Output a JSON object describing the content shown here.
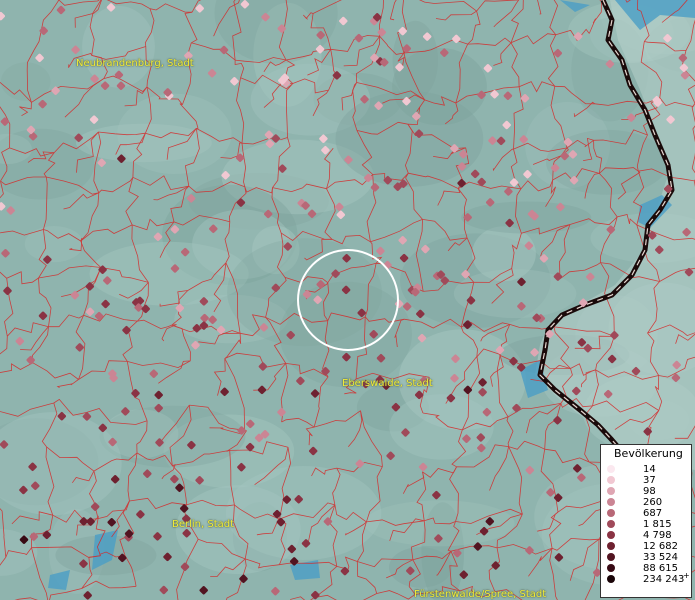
{
  "map": {
    "cities": [
      {
        "name": "Neubrandenburg, Stadt"
      },
      {
        "name": "Eberswalde, Stadt"
      },
      {
        "name": "Berlin, Stadt"
      },
      {
        "name": "Fürstenwalde/Spree, Stadt"
      }
    ],
    "legend": {
      "title": "Bevölkerung",
      "items": [
        {
          "label": "14",
          "color": "#fbe8ef"
        },
        {
          "label": "37",
          "color": "#f1c8d2"
        },
        {
          "label": "98",
          "color": "#dfa6b3"
        },
        {
          "label": "260",
          "color": "#cb8594"
        },
        {
          "label": "687",
          "color": "#b86877"
        },
        {
          "label": "1 815",
          "color": "#a04a5a"
        },
        {
          "label": "4 798",
          "color": "#8a3344"
        },
        {
          "label": "12 682",
          "color": "#6e2130"
        },
        {
          "label": "33 524",
          "color": "#521421"
        },
        {
          "label": "88 615",
          "color": "#380a14"
        },
        {
          "label": "234 243",
          "color": "#1a0408",
          "plus": "+"
        }
      ]
    },
    "colors": {
      "background": "#8fb4ae",
      "boundary": "#d42a2a",
      "border": "#1a0a0a",
      "water": "#4a9ec6",
      "label": "#f0ec3a"
    }
  }
}
